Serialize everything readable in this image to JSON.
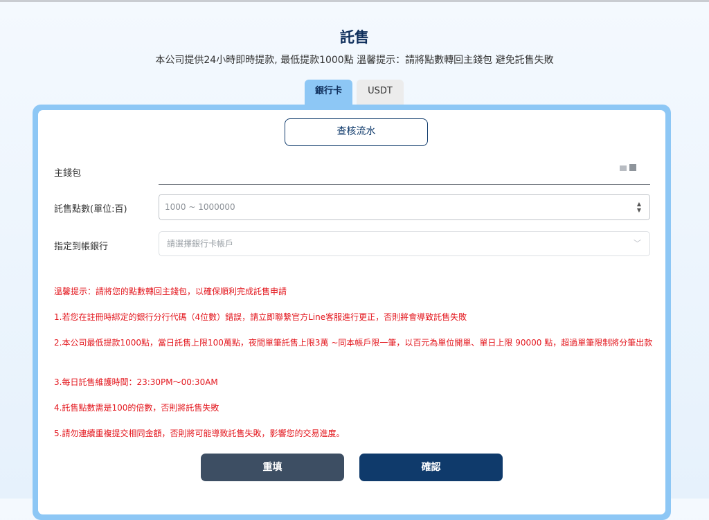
{
  "header": {
    "title": "託售",
    "subtitle": "本公司提供24小時即時提款, 最低提款1000點 溫馨提示：請將點數轉回主錢包 避免託售失敗"
  },
  "tabs": [
    {
      "label": "銀行卡",
      "active": true
    },
    {
      "label": "USDT",
      "active": false
    }
  ],
  "form": {
    "audit_button": "查核流水",
    "wallet_label": "主錢包",
    "points_label": "託售點數(單位:百)",
    "points_placeholder": "1000 ~ 1000000",
    "bank_label": "指定到帳銀行",
    "bank_placeholder": "請選擇銀行卡帳戶"
  },
  "notices": [
    "溫馨提示：請將您的點數轉回主錢包，以確保順利完成託售申請",
    "1.若您在註冊時綁定的銀行分行代碼（4位數）錯誤，請立即聯繫官方Line客服進行更正，否則將會導致託售失敗",
    "2.本公司最低提款1000點，當日託售上限100萬點，夜間單筆託售上限3萬 ~同本帳戶限一筆，以百元為單位開單、單日上限 90000 點，超過單筆限制將分筆出款",
    "3.每日託售維護時間：23:30PM～00:30AM",
    "4.託售點數需是100的倍數，否則將託售失敗",
    "5.請勿連續重複提交相同金額，否則將可能導致託售失敗，影響您的交易進度。"
  ],
  "buttons": {
    "reset": "重填",
    "confirm": "確認"
  },
  "colors": {
    "primary": "#0f3a6b",
    "tab_active": "#8dc7f5",
    "notice_red": "#e3161d",
    "reset_button": "#3d4e63"
  }
}
